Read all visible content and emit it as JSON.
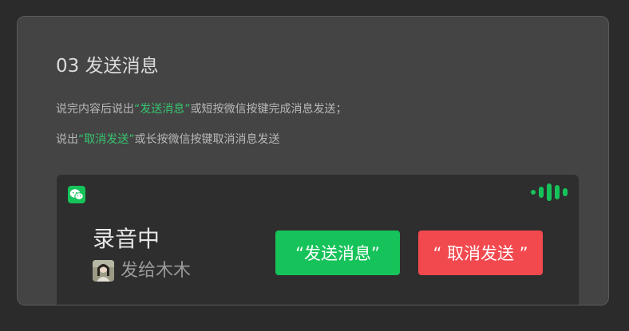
{
  "section": {
    "title": "03 发送消息",
    "line1": {
      "before": "说完内容后说出",
      "highlight": "“发送消息”",
      "after": "或短按微信按键完成消息发送；"
    },
    "line2": {
      "before": "说出",
      "highlight": "“取消发送”",
      "after": "或长按微信按键取消消息发送"
    }
  },
  "panel": {
    "app_icon": "wechat-icon",
    "signal_icon": "voice-level-icon",
    "status": "录音中",
    "recipient_prefix": "发给",
    "recipient_name": "木木",
    "send_button": "“发送消息”",
    "cancel_button": "“ 取消发送 ”"
  },
  "colors": {
    "accent_green": "#16c35a",
    "highlight_green": "#36c46e",
    "cancel_red": "#f2494f",
    "card_bg": "#444444",
    "panel_bg": "#2e2e2e"
  }
}
